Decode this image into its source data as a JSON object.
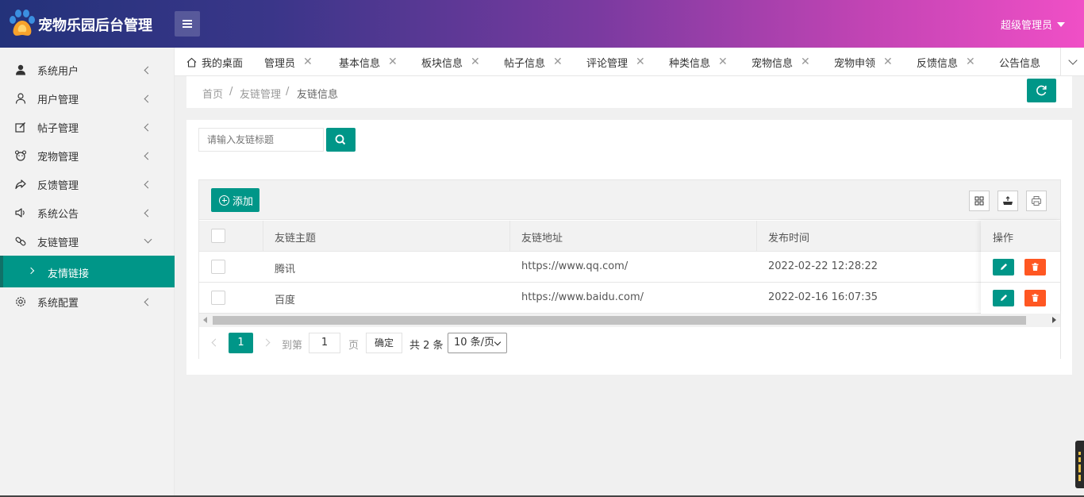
{
  "header": {
    "app_title": "宠物乐园后台管理",
    "user_label": "超级管理员",
    "brand_gradient": [
      "#23327a",
      "#7a3aa0",
      "#f04fc6"
    ]
  },
  "sidebar": {
    "items": [
      {
        "label": "系统用户",
        "icon": "user-solid-icon"
      },
      {
        "label": "用户管理",
        "icon": "user-outline-icon"
      },
      {
        "label": "帖子管理",
        "icon": "edit-icon"
      },
      {
        "label": "宠物管理",
        "icon": "bear-icon"
      },
      {
        "label": "反馈管理",
        "icon": "share-icon"
      },
      {
        "label": "系统公告",
        "icon": "speaker-icon"
      },
      {
        "label": "友链管理",
        "icon": "link-icon"
      },
      {
        "label": "系统配置",
        "icon": "gear-icon"
      }
    ],
    "sub_item": {
      "label": "友情链接"
    }
  },
  "tabs": [
    {
      "label": "我的桌面",
      "closable": false
    },
    {
      "label": "管理员",
      "closable": true
    },
    {
      "label": "基本信息",
      "closable": true
    },
    {
      "label": "板块信息",
      "closable": true
    },
    {
      "label": "帖子信息",
      "closable": true
    },
    {
      "label": "评论管理",
      "closable": true
    },
    {
      "label": "种类信息",
      "closable": true
    },
    {
      "label": "宠物信息",
      "closable": true
    },
    {
      "label": "宠物申领",
      "closable": true
    },
    {
      "label": "反馈信息",
      "closable": true
    },
    {
      "label": "公告信息",
      "closable": false
    }
  ],
  "tab_close_glyph": "✕",
  "breadcrumb": {
    "items": [
      "首页",
      "友链管理",
      "友链信息"
    ],
    "separator": "/"
  },
  "search": {
    "placeholder": "请输入友链标题"
  },
  "toolbar": {
    "add_label": "添加"
  },
  "table": {
    "columns": [
      "友链主题",
      "友链地址",
      "发布时间",
      "操作"
    ],
    "rows": [
      {
        "title": "腾讯",
        "url": "https://www.qq.com/",
        "time": "2022-02-22 12:28:22"
      },
      {
        "title": "百度",
        "url": "https://www.baidu.com/",
        "time": "2022-02-16 16:07:35"
      }
    ]
  },
  "pagination": {
    "current_page": "1",
    "goto_prefix": "到第",
    "goto_value": "1",
    "goto_suffix": "页",
    "confirm_label": "确定",
    "total_text": "共 2 条",
    "page_size": "10 条/页"
  },
  "colors": {
    "primary": "#009688",
    "danger": "#ff5722"
  }
}
